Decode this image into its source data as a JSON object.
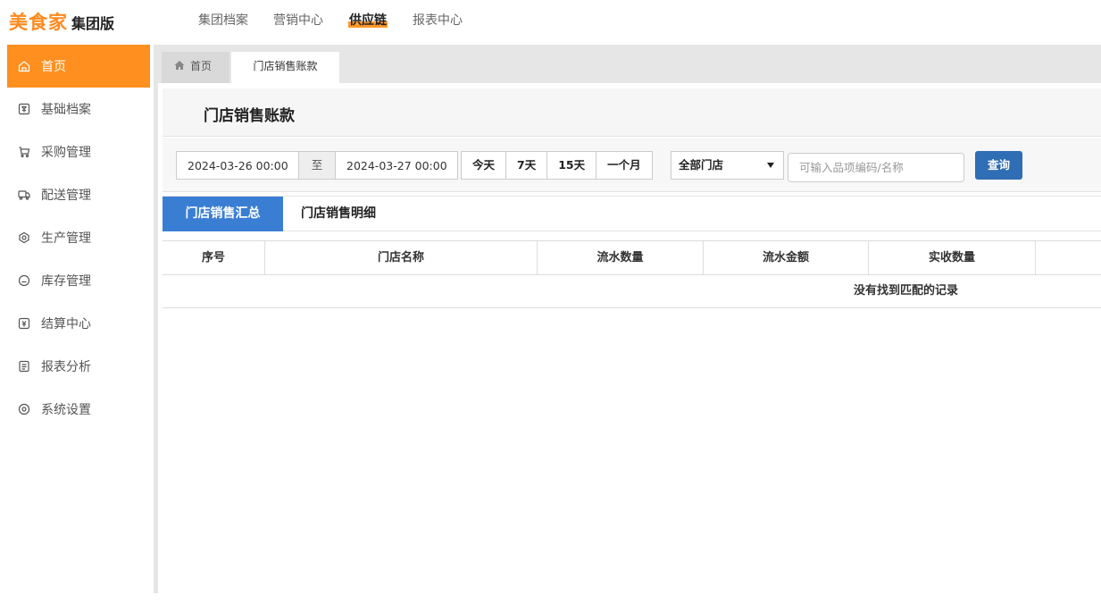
{
  "brand": {
    "logo_main": "美食家",
    "logo_sub": "集团版"
  },
  "topnav": {
    "items": [
      {
        "label": "集团档案"
      },
      {
        "label": "营销中心"
      },
      {
        "label": "供应链"
      },
      {
        "label": "报表中心"
      }
    ],
    "active": "供应链"
  },
  "sidebar": {
    "items": [
      {
        "label": "首页",
        "icon": "home-icon"
      },
      {
        "label": "基础档案",
        "icon": "archive-icon"
      },
      {
        "label": "采购管理",
        "icon": "cart-icon"
      },
      {
        "label": "配送管理",
        "icon": "truck-icon"
      },
      {
        "label": "生产管理",
        "icon": "production-icon"
      },
      {
        "label": "库存管理",
        "icon": "inventory-icon"
      },
      {
        "label": "结算中心",
        "icon": "settlement-icon"
      },
      {
        "label": "报表分析",
        "icon": "report-icon"
      },
      {
        "label": "系统设置",
        "icon": "settings-icon"
      }
    ],
    "active": "首页",
    "accent_color": "#ff8f1f"
  },
  "tabs": {
    "home_label": "首页",
    "active_label": "门店销售账款"
  },
  "page": {
    "title": "门店销售账款"
  },
  "filters": {
    "start_date": "2024-03-26 00:00",
    "separator": "至",
    "end_date": "2024-03-27 00:00",
    "quick_ranges": [
      "今天",
      "7天",
      "15天",
      "一个月"
    ],
    "store_select": "全部门店",
    "search_placeholder": "可输入品项编码/名称",
    "query_label": "查询",
    "query_color": "#2f6db4"
  },
  "subtabs": {
    "items": [
      "门店销售汇总",
      "门店销售明细"
    ],
    "active": "门店销售汇总",
    "active_color": "#3a7ed4"
  },
  "table": {
    "columns": [
      "序号",
      "门店名称",
      "流水数量",
      "流水金额",
      "实收数量",
      ""
    ],
    "empty_text": "没有找到匹配的记录"
  }
}
